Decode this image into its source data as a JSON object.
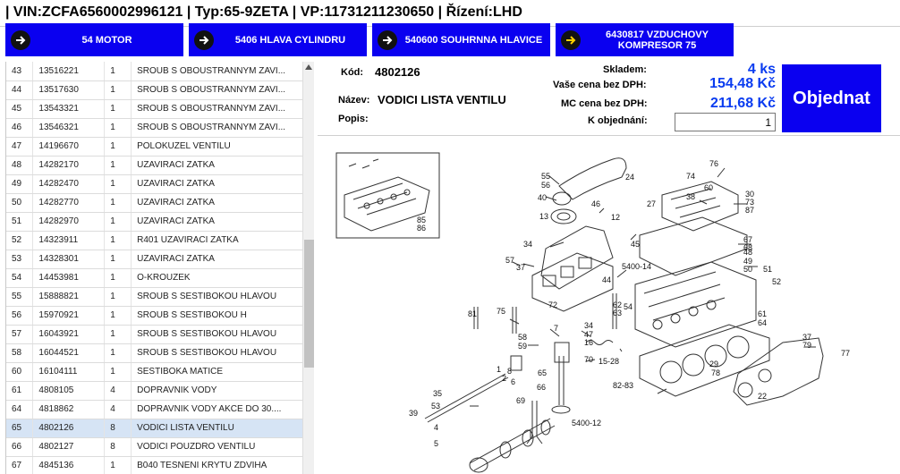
{
  "header": {
    "title": "| VIN:ZCFA6560002996121 | Typ:65-9ZETA | VP:11731211230650 | Řízení:LHD"
  },
  "breadcrumbs": [
    {
      "label": "54 MOTOR",
      "icon": "arrow-right-icon"
    },
    {
      "label": "5406 HLAVA CYLINDRU",
      "icon": "arrow-right-icon"
    },
    {
      "label": "540600 SOUHRNNA HLAVICE",
      "icon": "arrow-right-icon"
    },
    {
      "label": "6430817 VZDUCHOVY KOMPRESOR 75",
      "icon": "arrow-right-icon"
    }
  ],
  "parts": [
    {
      "pos": "43",
      "code": "13516221",
      "qty": "1",
      "desc": "SROUB S OBOUSTRANNYM ZAVI..."
    },
    {
      "pos": "44",
      "code": "13517630",
      "qty": "1",
      "desc": "SROUB S OBOUSTRANNYM ZAVI..."
    },
    {
      "pos": "45",
      "code": "13543321",
      "qty": "1",
      "desc": "SROUB S OBOUSTRANNYM ZAVI..."
    },
    {
      "pos": "46",
      "code": "13546321",
      "qty": "1",
      "desc": "SROUB S OBOUSTRANNYM ZAVI..."
    },
    {
      "pos": "47",
      "code": "14196670",
      "qty": "1",
      "desc": "POLOKUZEL VENTILU"
    },
    {
      "pos": "48",
      "code": "14282170",
      "qty": "1",
      "desc": "UZAVIRACI ZATKA"
    },
    {
      "pos": "49",
      "code": "14282470",
      "qty": "1",
      "desc": "UZAVIRACI ZATKA"
    },
    {
      "pos": "50",
      "code": "14282770",
      "qty": "1",
      "desc": "UZAVIRACI ZATKA"
    },
    {
      "pos": "51",
      "code": "14282970",
      "qty": "1",
      "desc": "UZAVIRACI ZATKA"
    },
    {
      "pos": "52",
      "code": "14323911",
      "qty": "1",
      "desc": "R401 UZAVIRACI ZATKA"
    },
    {
      "pos": "53",
      "code": "14328301",
      "qty": "1",
      "desc": "UZAVIRACI ZATKA"
    },
    {
      "pos": "54",
      "code": "14453981",
      "qty": "1",
      "desc": "O-KROUZEK"
    },
    {
      "pos": "55",
      "code": "15888821",
      "qty": "1",
      "desc": "SROUB S SESTIBOKOU HLAVOU"
    },
    {
      "pos": "56",
      "code": "15970921",
      "qty": "1",
      "desc": "SROUB S SESTIBOKOU H"
    },
    {
      "pos": "57",
      "code": "16043921",
      "qty": "1",
      "desc": "SROUB S SESTIBOKOU HLAVOU"
    },
    {
      "pos": "58",
      "code": "16044521",
      "qty": "1",
      "desc": "SROUB S SESTIBOKOU HLAVOU"
    },
    {
      "pos": "60",
      "code": "16104111",
      "qty": "1",
      "desc": "SESTIBOKA MATICE"
    },
    {
      "pos": "61",
      "code": "4808105",
      "qty": "4",
      "desc": "DOPRAVNIK VODY"
    },
    {
      "pos": "64",
      "code": "4818862",
      "qty": "4",
      "desc": "DOPRAVNIK VODY AKCE DO 30...."
    },
    {
      "pos": "65",
      "code": "4802126",
      "qty": "8",
      "desc": "VODICI LISTA VENTILU"
    },
    {
      "pos": "66",
      "code": "4802127",
      "qty": "8",
      "desc": "VODICI POUZDRO VENTILU"
    },
    {
      "pos": "67",
      "code": "4845136",
      "qty": "1",
      "desc": "B040 TESNENI KRYTU ZDVIHA"
    }
  ],
  "selected_pos": "65",
  "detail": {
    "kod_label": "Kód:",
    "kod_value": "4802126",
    "nazev_label": "Název:",
    "nazev_value": "VODICI LISTA VENTILU",
    "popis_label": "Popis:",
    "sklad_label": "Skladem:",
    "sklad_value": "4 ks",
    "cena_label": "Vaše cena bez DPH:",
    "cena_value": "154,48 Kč",
    "mc_label": "MC cena bez DPH:",
    "mc_value": "211,68 Kč",
    "objednani_label": "K objednání:",
    "objednani_value": "1",
    "order_button": "Objednat"
  },
  "diagram": {
    "callouts": [
      "55",
      "56",
      "40",
      "24",
      "46",
      "13",
      "12",
      "74",
      "76",
      "60",
      "38",
      "27",
      "30",
      "73",
      "87",
      "67",
      "68",
      "34",
      "45",
      "57",
      "37",
      "5400-14",
      "44",
      "48",
      "49",
      "50",
      "51",
      "52",
      "1",
      "2",
      "72",
      "81",
      "75",
      "54",
      "61",
      "64",
      "62",
      "63",
      "58",
      "59",
      "7",
      "34",
      "47",
      "16",
      "70",
      "15-28",
      "65",
      "66",
      "35",
      "53",
      "39",
      "4",
      "5",
      "6",
      "8",
      "69",
      "5400-12",
      "82-83",
      "29",
      "78",
      "22",
      "37",
      "79",
      "77",
      "85",
      "86"
    ],
    "fraction_labels": [
      "4/8",
      "29/78",
      "37/79",
      "65/66",
      "85/86",
      "61/64",
      "30/73/87",
      "67/68",
      "48/49/50",
      "55/56",
      "15-28"
    ]
  }
}
